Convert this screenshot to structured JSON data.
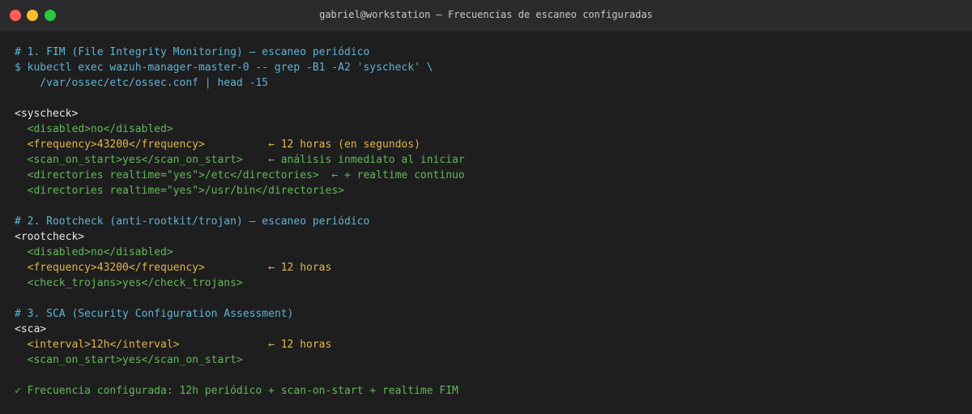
{
  "window": {
    "title": "gabriel@workstation — Frecuencias de escaneo configuradas"
  },
  "terminal": {
    "lines": [
      "# 1. FIM (File Integrity Monitoring) — escaneo periódico",
      "$ kubectl exec wazuh-manager-master-0 -- grep -B1 -A2 'syscheck' \\",
      "    /var/ossec/etc/ossec.conf | head -15",
      "",
      "<syscheck>",
      "  <disabled>no</disabled>",
      "  <frequency>43200</frequency>          ← 12 horas (en segundos)",
      "  <scan_on_start>yes</scan_on_start>    ← análisis inmediato al iniciar",
      "  <directories realtime=\"yes\">/etc</directories>  ← + realtime continuo",
      "  <directories realtime=\"yes\">/usr/bin</directories>",
      "",
      "# 2. Rootcheck (anti-rootkit/trojan) — escaneo periódico",
      "<rootcheck>",
      "  <disabled>no</disabled>",
      "  <frequency>43200</frequency>          ← 12 horas",
      "  <check_trojans>yes</check_trojans>",
      "",
      "# 3. SCA (Security Configuration Assessment)",
      "<sca>",
      "  <interval>12h</interval>              ← 12 horas",
      "  <scan_on_start>yes</scan_on_start>",
      "",
      "✓ Frecuencia configurada: 12h periódico + scan-on-start + realtime FIM"
    ]
  },
  "colors": {
    "comment": "#5fb4d4",
    "tag": "#e6e6e6",
    "config": "#62b856",
    "highlight": "#e4b44a",
    "success": "#62b856"
  }
}
